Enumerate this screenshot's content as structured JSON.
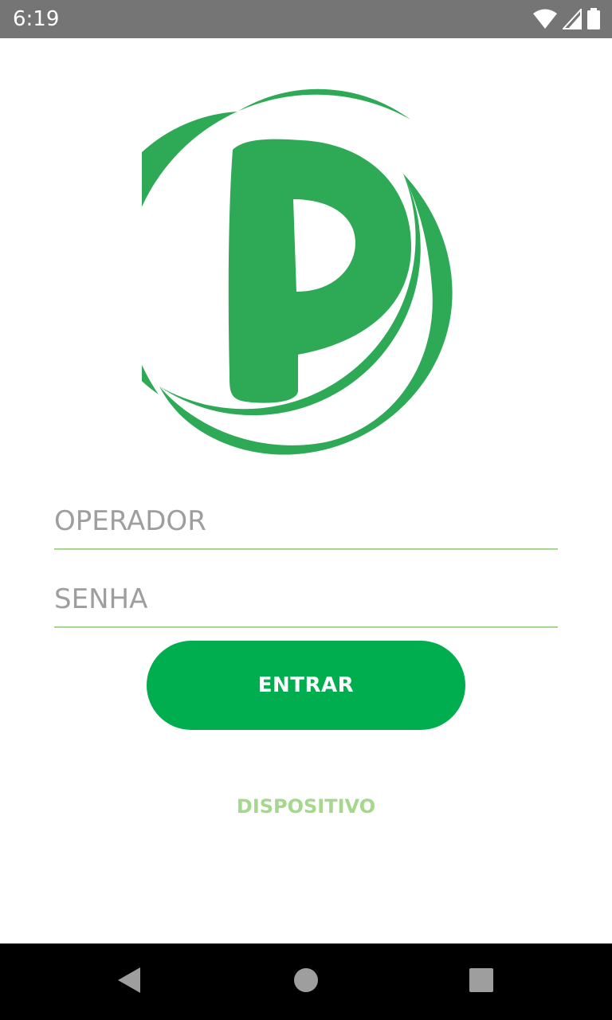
{
  "status_bar": {
    "time": "6:19",
    "icons": [
      "wifi-icon",
      "signal-icon",
      "battery-icon"
    ]
  },
  "login": {
    "operador_placeholder": "OPERADOR",
    "senha_placeholder": "SENHA",
    "entrar_label": "ENTRAR",
    "dispositivo_label": "DISPOSITIVO"
  },
  "navigation": {
    "icons": [
      "back-icon",
      "home-icon",
      "recents-icon"
    ]
  },
  "colors": {
    "brand_green": "#2eaa57",
    "button_green": "#00ae50",
    "accent_light_green": "#a5d88d",
    "placeholder_gray": "#9e9e9e",
    "status_bar": "#757575",
    "nav_bar": "#000000"
  }
}
